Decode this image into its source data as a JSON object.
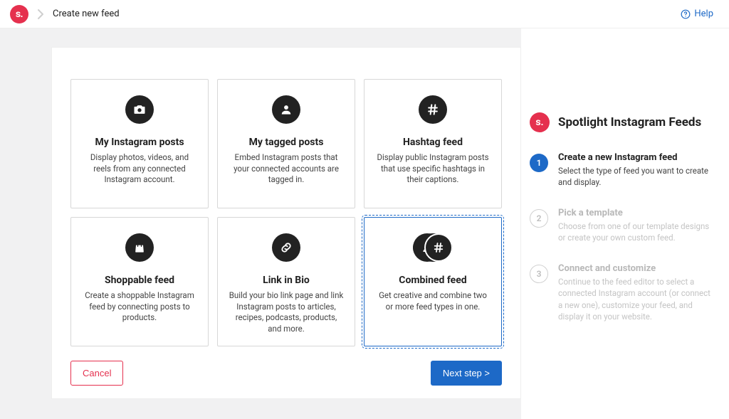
{
  "header": {
    "logo_text": "s.",
    "breadcrumb": "Create new feed",
    "help_label": "Help"
  },
  "tiles": [
    {
      "title": "My Instagram posts",
      "desc": "Display photos, videos, and reels from any connected Instagram account.",
      "icon": "camera",
      "selected": false
    },
    {
      "title": "My tagged posts",
      "desc": "Embed Instagram posts that your connected accounts are tagged in.",
      "icon": "person",
      "selected": false
    },
    {
      "title": "Hashtag feed",
      "desc": "Display public Instagram posts that use specific hashtags in their captions.",
      "icon": "hashtag",
      "selected": false
    },
    {
      "title": "Shoppable feed",
      "desc": "Create a shoppable Instagram feed by connecting posts to products.",
      "icon": "bag",
      "selected": false
    },
    {
      "title": "Link in Bio",
      "desc": "Build your bio link page and link Instagram posts to articles, recipes, podcasts, products, and more.",
      "icon": "link",
      "selected": false
    },
    {
      "title": "Combined feed",
      "desc": "Get creative and combine two or more feed types in one.",
      "icon": "combined",
      "selected": true
    }
  ],
  "footer": {
    "cancel_label": "Cancel",
    "next_label": "Next step >"
  },
  "sidebar": {
    "logo_text": "s.",
    "title": "Spotlight Instagram Feeds",
    "steps": [
      {
        "num": "1",
        "title": "Create a new Instagram feed",
        "desc": "Select the type of feed you want to create and display.",
        "active": true
      },
      {
        "num": "2",
        "title": "Pick a template",
        "desc": "Choose from one of our template designs or create your own custom feed.",
        "active": false
      },
      {
        "num": "3",
        "title": "Connect and customize",
        "desc": "Continue to the feed editor to select a connected Instagram account (or connect a new one), customize your feed, and display it on your website.",
        "active": false
      }
    ]
  }
}
